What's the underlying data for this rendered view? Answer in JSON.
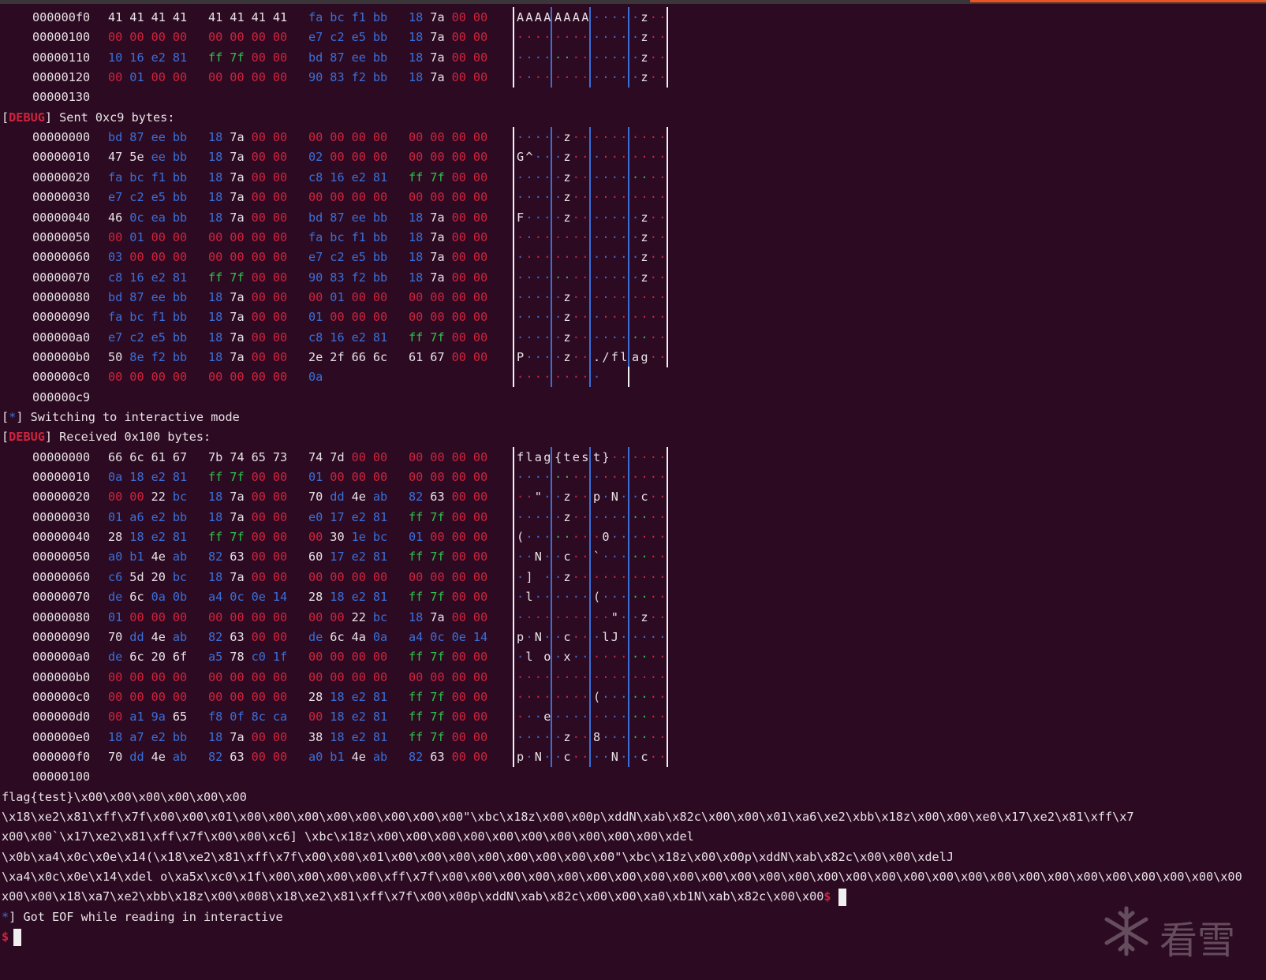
{
  "colors": {
    "background": "#2c0b22",
    "text": "#e8e2e6",
    "red": "#d0233d",
    "blue": "#3a6fd8",
    "green": "#30c04a",
    "accent": "#e95420"
  },
  "dump1": {
    "rows": [
      {
        "off": "000000f0",
        "bytes": [
          "41",
          "41",
          "41",
          "41",
          "41",
          "41",
          "41",
          "41",
          "fa",
          "bc",
          "f1",
          "bb",
          "18",
          "7a",
          "00",
          "00"
        ],
        "ascii": "AAAAAAAA....z.."
      },
      {
        "off": "00000100",
        "bytes": [
          "00",
          "00",
          "00",
          "00",
          "00",
          "00",
          "00",
          "00",
          "e7",
          "c2",
          "e5",
          "bb",
          "18",
          "7a",
          "00",
          "00"
        ],
        "ascii": "............z.."
      },
      {
        "off": "00000110",
        "bytes": [
          "10",
          "16",
          "e2",
          "81",
          "ff",
          "7f",
          "00",
          "00",
          "bd",
          "87",
          "ee",
          "bb",
          "18",
          "7a",
          "00",
          "00"
        ],
        "ascii": "............z.."
      },
      {
        "off": "00000120",
        "bytes": [
          "00",
          "01",
          "00",
          "00",
          "00",
          "00",
          "00",
          "00",
          "90",
          "83",
          "f2",
          "bb",
          "18",
          "7a",
          "00",
          "00"
        ],
        "ascii": "............z.."
      }
    ],
    "end": "00000130"
  },
  "sent_header": {
    "open": "[",
    "tag": "DEBUG",
    "close": "] Sent 0xc9 bytes:"
  },
  "dump2": {
    "rows": [
      {
        "off": "00000000",
        "bytes": [
          "bd",
          "87",
          "ee",
          "bb",
          "18",
          "7a",
          "00",
          "00",
          "00",
          "00",
          "00",
          "00",
          "00",
          "00",
          "00",
          "00"
        ],
        "ascii": "....z..........."
      },
      {
        "off": "00000010",
        "bytes": [
          "47",
          "5e",
          "ee",
          "bb",
          "18",
          "7a",
          "00",
          "00",
          "02",
          "00",
          "00",
          "00",
          "00",
          "00",
          "00",
          "00"
        ],
        "ascii": "G^..z..........."
      },
      {
        "off": "00000020",
        "bytes": [
          "fa",
          "bc",
          "f1",
          "bb",
          "18",
          "7a",
          "00",
          "00",
          "c8",
          "16",
          "e2",
          "81",
          "ff",
          "7f",
          "00",
          "00"
        ],
        "ascii": "....z..........."
      },
      {
        "off": "00000030",
        "bytes": [
          "e7",
          "c2",
          "e5",
          "bb",
          "18",
          "7a",
          "00",
          "00",
          "00",
          "00",
          "00",
          "00",
          "00",
          "00",
          "00",
          "00"
        ],
        "ascii": "....z..........."
      },
      {
        "off": "00000040",
        "bytes": [
          "46",
          "0c",
          "ea",
          "bb",
          "18",
          "7a",
          "00",
          "00",
          "bd",
          "87",
          "ee",
          "bb",
          "18",
          "7a",
          "00",
          "00"
        ],
        "ascii": "F...z.......z..."
      },
      {
        "off": "00000050",
        "bytes": [
          "00",
          "01",
          "00",
          "00",
          "00",
          "00",
          "00",
          "00",
          "fa",
          "bc",
          "f1",
          "bb",
          "18",
          "7a",
          "00",
          "00"
        ],
        "ascii": "............z..."
      },
      {
        "off": "00000060",
        "bytes": [
          "03",
          "00",
          "00",
          "00",
          "00",
          "00",
          "00",
          "00",
          "e7",
          "c2",
          "e5",
          "bb",
          "18",
          "7a",
          "00",
          "00"
        ],
        "ascii": "............z..."
      },
      {
        "off": "00000070",
        "bytes": [
          "c8",
          "16",
          "e2",
          "81",
          "ff",
          "7f",
          "00",
          "00",
          "90",
          "83",
          "f2",
          "bb",
          "18",
          "7a",
          "00",
          "00"
        ],
        "ascii": "............z..."
      },
      {
        "off": "00000080",
        "bytes": [
          "bd",
          "87",
          "ee",
          "bb",
          "18",
          "7a",
          "00",
          "00",
          "00",
          "01",
          "00",
          "00",
          "00",
          "00",
          "00",
          "00"
        ],
        "ascii": "....z..........."
      },
      {
        "off": "00000090",
        "bytes": [
          "fa",
          "bc",
          "f1",
          "bb",
          "18",
          "7a",
          "00",
          "00",
          "01",
          "00",
          "00",
          "00",
          "00",
          "00",
          "00",
          "00"
        ],
        "ascii": "....z..........."
      },
      {
        "off": "000000a0",
        "bytes": [
          "e7",
          "c2",
          "e5",
          "bb",
          "18",
          "7a",
          "00",
          "00",
          "c8",
          "16",
          "e2",
          "81",
          "ff",
          "7f",
          "00",
          "00"
        ],
        "ascii": "....z..........."
      },
      {
        "off": "000000b0",
        "bytes": [
          "50",
          "8e",
          "f2",
          "bb",
          "18",
          "7a",
          "00",
          "00",
          "2e",
          "2f",
          "66",
          "6c",
          "61",
          "67",
          "00",
          "00"
        ],
        "ascii": "P...z..../flag.."
      },
      {
        "off": "000000c0",
        "bytes": [
          "00",
          "00",
          "00",
          "00",
          "00",
          "00",
          "00",
          "00",
          "0a"
        ],
        "ascii": "........."
      }
    ],
    "end": "000000c9"
  },
  "interactive_line": {
    "open": "[",
    "star": "*",
    "close": "] Switching to interactive mode"
  },
  "recv_header": {
    "open": "[",
    "tag": "DEBUG",
    "close": "] Received 0x100 bytes:"
  },
  "dump3": {
    "rows": [
      {
        "off": "00000000",
        "bytes": [
          "66",
          "6c",
          "61",
          "67",
          "7b",
          "74",
          "65",
          "73",
          "74",
          "7d",
          "00",
          "00",
          "00",
          "00",
          "00",
          "00"
        ],
        "ascii": "flag{test}......"
      },
      {
        "off": "00000010",
        "bytes": [
          "0a",
          "18",
          "e2",
          "81",
          "ff",
          "7f",
          "00",
          "00",
          "01",
          "00",
          "00",
          "00",
          "00",
          "00",
          "00",
          "00"
        ],
        "ascii": "................"
      },
      {
        "off": "00000020",
        "bytes": [
          "00",
          "00",
          "22",
          "bc",
          "18",
          "7a",
          "00",
          "00",
          "70",
          "dd",
          "4e",
          "ab",
          "82",
          "63",
          "00",
          "00"
        ],
        "ascii": "..\"..z..p.N..c.."
      },
      {
        "off": "00000030",
        "bytes": [
          "01",
          "a6",
          "e2",
          "bb",
          "18",
          "7a",
          "00",
          "00",
          "e0",
          "17",
          "e2",
          "81",
          "ff",
          "7f",
          "00",
          "00"
        ],
        "ascii": "....z..........."
      },
      {
        "off": "00000040",
        "bytes": [
          "28",
          "18",
          "e2",
          "81",
          "ff",
          "7f",
          "00",
          "00",
          "00",
          "30",
          "1e",
          "bc",
          "01",
          "00",
          "00",
          "00"
        ],
        "ascii": "(........0......"
      },
      {
        "off": "00000050",
        "bytes": [
          "a0",
          "b1",
          "4e",
          "ab",
          "82",
          "63",
          "00",
          "00",
          "60",
          "17",
          "e2",
          "81",
          "ff",
          "7f",
          "00",
          "00"
        ],
        "ascii": "..N..c..`......."
      },
      {
        "off": "00000060",
        "bytes": [
          "c6",
          "5d",
          "20",
          "bc",
          "18",
          "7a",
          "00",
          "00",
          "00",
          "00",
          "00",
          "00",
          "00",
          "00",
          "00",
          "00"
        ],
        "ascii": ".] ..z.........."
      },
      {
        "off": "00000070",
        "bytes": [
          "de",
          "6c",
          "0a",
          "0b",
          "a4",
          "0c",
          "0e",
          "14",
          "28",
          "18",
          "e2",
          "81",
          "ff",
          "7f",
          "00",
          "00"
        ],
        "ascii": ".l......(......."
      },
      {
        "off": "00000080",
        "bytes": [
          "01",
          "00",
          "00",
          "00",
          "00",
          "00",
          "00",
          "00",
          "00",
          "00",
          "22",
          "bc",
          "18",
          "7a",
          "00",
          "00"
        ],
        "ascii": "..........\"..z.."
      },
      {
        "off": "00000090",
        "bytes": [
          "70",
          "dd",
          "4e",
          "ab",
          "82",
          "63",
          "00",
          "00",
          "de",
          "6c",
          "4a",
          "0a",
          "a4",
          "0c",
          "0e",
          "14"
        ],
        "ascii": "p.N..c...lJ....."
      },
      {
        "off": "000000a0",
        "bytes": [
          "de",
          "6c",
          "20",
          "6f",
          "a5",
          "78",
          "c0",
          "1f",
          "00",
          "00",
          "00",
          "00",
          "ff",
          "7f",
          "00",
          "00"
        ],
        "ascii": ".l o.x.........."
      },
      {
        "off": "000000b0",
        "bytes": [
          "00",
          "00",
          "00",
          "00",
          "00",
          "00",
          "00",
          "00",
          "00",
          "00",
          "00",
          "00",
          "00",
          "00",
          "00",
          "00"
        ],
        "ascii": "................"
      },
      {
        "off": "000000c0",
        "bytes": [
          "00",
          "00",
          "00",
          "00",
          "00",
          "00",
          "00",
          "00",
          "28",
          "18",
          "e2",
          "81",
          "ff",
          "7f",
          "00",
          "00"
        ],
        "ascii": "........(......."
      },
      {
        "off": "000000d0",
        "bytes": [
          "00",
          "a1",
          "9a",
          "65",
          "f8",
          "0f",
          "8c",
          "ca",
          "00",
          "18",
          "e2",
          "81",
          "ff",
          "7f",
          "00",
          "00"
        ],
        "ascii": "...e............"
      },
      {
        "off": "000000e0",
        "bytes": [
          "18",
          "a7",
          "e2",
          "bb",
          "18",
          "7a",
          "00",
          "00",
          "38",
          "18",
          "e2",
          "81",
          "ff",
          "7f",
          "00",
          "00"
        ],
        "ascii": "....z...8......."
      },
      {
        "off": "000000f0",
        "bytes": [
          "70",
          "dd",
          "4e",
          "ab",
          "82",
          "63",
          "00",
          "00",
          "a0",
          "b1",
          "4e",
          "ab",
          "82",
          "63",
          "00",
          "00"
        ],
        "ascii": "p.N..c....N..c.."
      }
    ],
    "end": "00000100"
  },
  "raw_lines": [
    "flag{test}\\x00\\x00\\x00\\x00\\x00\\x00",
    "\\x18\\xe2\\x81\\xff\\x7f\\x00\\x00\\x01\\x00\\x00\\x00\\x00\\x00\\x00\\x00\\x00\"\\xbc\\x18z\\x00\\x00p\\xddN\\xab\\x82c\\x00\\x00\\x01\\xa6\\xe2\\xbb\\x18z\\x00\\x00\\xe0\\x17\\xe2\\x81\\xff\\x7",
    "x00\\x00`\\x17\\xe2\\x81\\xff\\x7f\\x00\\x00\\xc6] \\xbc\\x18z\\x00\\x00\\x00\\x00\\x00\\x00\\x00\\x00\\x00\\x00\\xdel",
    "\\x0b\\xa4\\x0c\\x0e\\x14(\\x18\\xe2\\x81\\xff\\x7f\\x00\\x00\\x01\\x00\\x00\\x00\\x00\\x00\\x00\\x00\\x00\"\\xbc\\x18z\\x00\\x00p\\xddN\\xab\\x82c\\x00\\x00\\xdelJ",
    "\\xa4\\x0c\\x0e\\x14\\xdel o\\xa5x\\xc0\\x1f\\x00\\x00\\x00\\x00\\xff\\x7f\\x00\\x00\\x00\\x00\\x00\\x00\\x00\\x00\\x00\\x00\\x00\\x00\\x00\\x00\\x00\\x00\\x00\\x00\\x00\\x00\\x00\\x00\\x00\\x00\\x00\\x00\\x00\\x00",
    "x00\\x00\\x18\\xa7\\xe2\\xbb\\x18z\\x00\\x008\\x18\\xe2\\x81\\xff\\x7f\\x00\\x00p\\xddN\\xab\\x82c\\x00\\x00\\xa0\\xb1N\\xab\\x82c\\x00\\x00"
  ],
  "raw_prompt": "$",
  "eof_line": {
    "star": "*",
    "text": "] Got EOF while reading in interactive"
  },
  "final_prompt": "$",
  "watermark": {
    "text": "看雪",
    "icon": "snowflake-icon"
  }
}
